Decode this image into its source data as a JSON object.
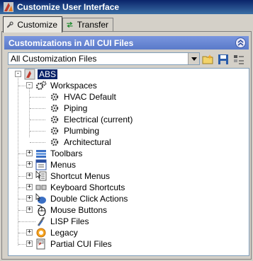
{
  "window": {
    "title": "Customize User Interface"
  },
  "tabs": [
    {
      "label": "Customize",
      "icon": "wrench-icon",
      "active": true
    },
    {
      "label": "Transfer",
      "icon": "transfer-arrows-icon",
      "active": false
    }
  ],
  "panel": {
    "header": "Customizations in All CUI Files",
    "file_select": {
      "value": "All Customization Files"
    },
    "toolbar": [
      {
        "name": "open-file-icon"
      },
      {
        "name": "save-icon"
      },
      {
        "name": "list-view-icon"
      }
    ]
  },
  "tree": {
    "root": {
      "label": "ABS",
      "icon": "cui-file-icon"
    },
    "items": [
      {
        "label": "Workspaces",
        "icon": "gears-icon",
        "children": [
          {
            "label": "HVAC Default",
            "icon": "gear-icon"
          },
          {
            "label": "Piping",
            "icon": "gear-icon"
          },
          {
            "label": "Electrical (current)",
            "icon": "gear-icon"
          },
          {
            "label": "Plumbing",
            "icon": "gear-icon"
          },
          {
            "label": "Architectural",
            "icon": "gear-icon"
          }
        ]
      },
      {
        "label": "Toolbars",
        "icon": "toolbar-icon"
      },
      {
        "label": "Menus",
        "icon": "menu-icon"
      },
      {
        "label": "Shortcut Menus",
        "icon": "shortcut-menu-icon"
      },
      {
        "label": "Keyboard Shortcuts",
        "icon": "keyboard-icon"
      },
      {
        "label": "Double Click Actions",
        "icon": "double-click-icon"
      },
      {
        "label": "Mouse Buttons",
        "icon": "mouse-icon"
      },
      {
        "label": "LISP Files",
        "icon": "lisp-icon"
      },
      {
        "label": "Legacy",
        "icon": "legacy-icon"
      },
      {
        "label": "Partial CUI Files",
        "icon": "partial-cui-icon"
      }
    ]
  }
}
